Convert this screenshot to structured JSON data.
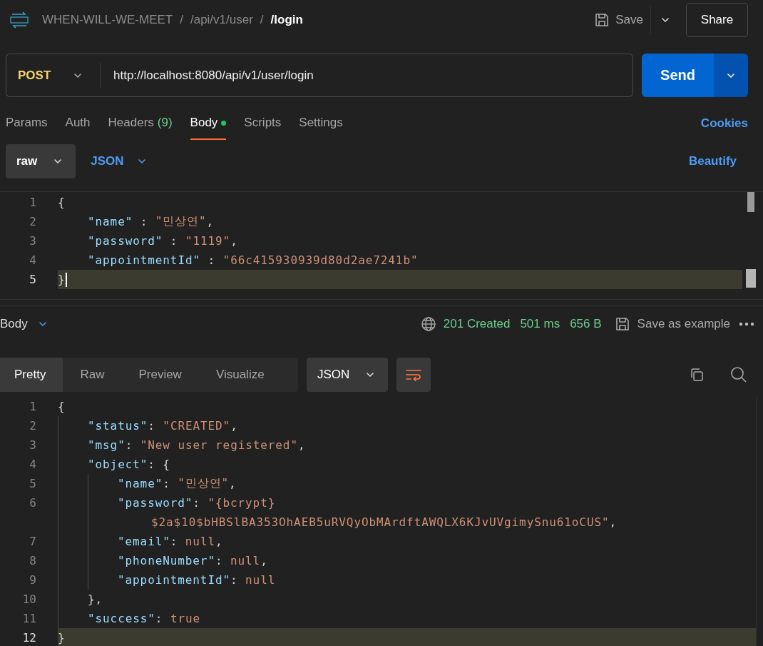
{
  "header": {
    "breadcrumbs": [
      {
        "text": "WHEN-WILL-WE-MEET",
        "current": false
      },
      {
        "text": "/api/v1/user",
        "current": false
      },
      {
        "text": "/login",
        "current": true
      }
    ],
    "separator": "/",
    "save_label": "Save",
    "share_label": "Share"
  },
  "request": {
    "method": "POST",
    "url": "http://localhost:8080/api/v1/user/login",
    "send_label": "Send"
  },
  "tabs": [
    {
      "label": "Params",
      "selected": false,
      "has_content": false
    },
    {
      "label": "Auth",
      "selected": false,
      "has_content": false
    },
    {
      "label": "Headers",
      "count": "(9)",
      "selected": false,
      "has_content": false
    },
    {
      "label": "Body",
      "selected": true,
      "has_content": true
    },
    {
      "label": "Scripts",
      "selected": false,
      "has_content": false
    },
    {
      "label": "Settings",
      "selected": false,
      "has_content": false
    }
  ],
  "cookies_label": "Cookies",
  "body_options": {
    "mode": "raw",
    "language": "JSON",
    "beautify_label": "Beautify"
  },
  "request_body": {
    "lines": [
      {
        "number": "1",
        "current": false,
        "tokens": [
          {
            "kind": "punct",
            "text": "{"
          }
        ],
        "children": [
          {
            "number": "2",
            "current": false,
            "tokens": [
              {
                "kind": "key",
                "text": "\"name\""
              },
              {
                "kind": "punct",
                "text": " : "
              },
              {
                "kind": "string",
                "text": "\"민상연\""
              },
              {
                "kind": "punct",
                "text": ","
              }
            ]
          },
          {
            "number": "3",
            "current": false,
            "tokens": [
              {
                "kind": "key",
                "text": "\"password\""
              },
              {
                "kind": "punct",
                "text": " : "
              },
              {
                "kind": "string",
                "text": "\"1119\""
              },
              {
                "kind": "punct",
                "text": ","
              }
            ]
          },
          {
            "number": "4",
            "current": false,
            "tokens": [
              {
                "kind": "key",
                "text": "\"appointmentId\""
              },
              {
                "kind": "punct",
                "text": " : "
              },
              {
                "kind": "string",
                "text": "\"66c415930939d80d2ae7241b\""
              }
            ]
          }
        ]
      },
      {
        "number": "5",
        "current": true,
        "tokens": [
          {
            "kind": "punct",
            "text": "}"
          }
        ]
      }
    ]
  },
  "response": {
    "section_label": "Body",
    "status": "201 Created",
    "time": "501 ms",
    "size": "656 B",
    "save_example_label": "Save as example",
    "view_tabs": [
      {
        "label": "Pretty",
        "selected": true
      },
      {
        "label": "Raw",
        "selected": false
      },
      {
        "label": "Preview",
        "selected": false
      },
      {
        "label": "Visualize",
        "selected": false
      }
    ],
    "format": "JSON",
    "lines": [
      {
        "number": "1",
        "current": false,
        "tokens": [
          {
            "kind": "punct",
            "text": "{"
          }
        ],
        "children": [
          {
            "number": "2",
            "current": false,
            "tokens": [
              {
                "kind": "key",
                "text": "\"status\""
              },
              {
                "kind": "punct",
                "text": ": "
              },
              {
                "kind": "string",
                "text": "\"CREATED\""
              },
              {
                "kind": "punct",
                "text": ","
              }
            ]
          },
          {
            "number": "3",
            "current": false,
            "tokens": [
              {
                "kind": "key",
                "text": "\"msg\""
              },
              {
                "kind": "punct",
                "text": ": "
              },
              {
                "kind": "string",
                "text": "\"New user registered\""
              },
              {
                "kind": "punct",
                "text": ","
              }
            ]
          },
          {
            "number": "4",
            "current": false,
            "tokens": [
              {
                "kind": "key",
                "text": "\"object\""
              },
              {
                "kind": "punct",
                "text": ": {"
              }
            ],
            "children": [
              {
                "number": "5",
                "current": false,
                "tokens": [
                  {
                    "kind": "key",
                    "text": "\"name\""
                  },
                  {
                    "kind": "punct",
                    "text": ": "
                  },
                  {
                    "kind": "string",
                    "text": "\"민상연\""
                  },
                  {
                    "kind": "punct",
                    "text": ","
                  }
                ]
              },
              {
                "number": "6",
                "current": false,
                "tokens": [
                  {
                    "kind": "key",
                    "text": "\"password\""
                  },
                  {
                    "kind": "punct",
                    "text": ": "
                  },
                  {
                    "kind": "string",
                    "text": "\"{bcrypt}"
                  }
                ],
                "wrap": [
                  {
                    "kind": "string",
                    "text": "$2a$10$bHBSlBA353OhAEB5uRVQyObMArdftAWQLX6KJvUVgimySnu61oCUS\""
                  },
                  {
                    "kind": "punct",
                    "text": ","
                  }
                ]
              },
              {
                "number": "7",
                "current": false,
                "tokens": [
                  {
                    "kind": "key",
                    "text": "\"email\""
                  },
                  {
                    "kind": "punct",
                    "text": ": "
                  },
                  {
                    "kind": "literal",
                    "text": "null"
                  },
                  {
                    "kind": "punct",
                    "text": ","
                  }
                ]
              },
              {
                "number": "8",
                "current": false,
                "tokens": [
                  {
                    "kind": "key",
                    "text": "\"phoneNumber\""
                  },
                  {
                    "kind": "punct",
                    "text": ": "
                  },
                  {
                    "kind": "literal",
                    "text": "null"
                  },
                  {
                    "kind": "punct",
                    "text": ","
                  }
                ]
              },
              {
                "number": "9",
                "current": false,
                "tokens": [
                  {
                    "kind": "key",
                    "text": "\"appointmentId\""
                  },
                  {
                    "kind": "punct",
                    "text": ": "
                  },
                  {
                    "kind": "literal",
                    "text": "null"
                  }
                ]
              }
            ]
          },
          {
            "number": "10",
            "current": false,
            "tokens": [
              {
                "kind": "punct",
                "text": "},"
              }
            ]
          },
          {
            "number": "11",
            "current": false,
            "tokens": [
              {
                "kind": "key",
                "text": "\"success\""
              },
              {
                "kind": "punct",
                "text": ": "
              },
              {
                "kind": "literal",
                "text": "true"
              }
            ]
          }
        ]
      },
      {
        "number": "12",
        "current": true,
        "tokens": [
          {
            "kind": "punct",
            "text": "}"
          }
        ]
      }
    ]
  }
}
